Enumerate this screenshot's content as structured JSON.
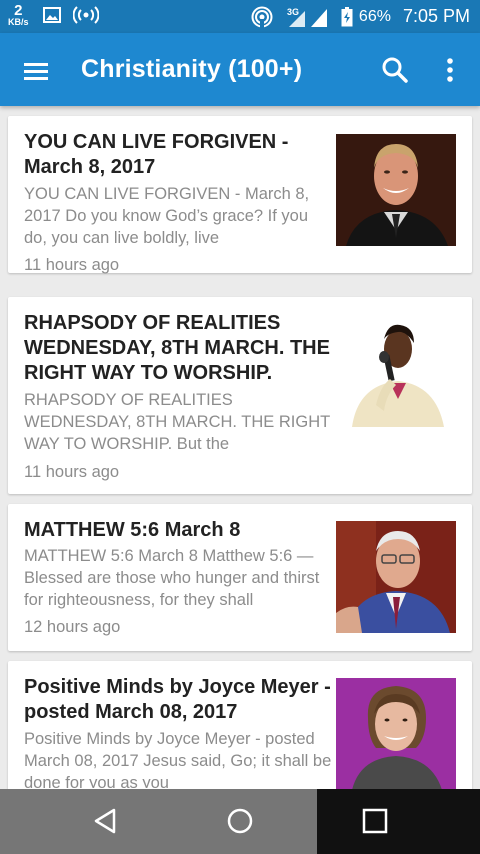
{
  "status_bar": {
    "net_speed_value": "2",
    "net_speed_unit": "KB/s",
    "battery": "66%",
    "time": "7:05 PM",
    "icons": [
      "image-icon",
      "broadcast-icon",
      "hotspot-icon",
      "3g-signal-icon",
      "battery-icon"
    ]
  },
  "app_bar": {
    "title": "Christianity (100+)",
    "icons": [
      "hamburger-menu-icon",
      "search-icon",
      "more-vert-icon"
    ]
  },
  "articles": [
    {
      "headline": "YOU CAN LIVE FORGIVEN - March 8, 2017",
      "summary": "YOU CAN LIVE FORGIVEN - March 8, 2017 Do you know God’s grace? If you do, you can live boldly, live",
      "time": "11 hours ago",
      "thumbnail": "preacher-portrait"
    },
    {
      "headline": "RHAPSODY OF REALITIES WEDNESDAY, 8TH MARCH. THE RIGHT WAY TO WORSHIP.",
      "summary": "RHAPSODY OF REALITIES WEDNESDAY, 8TH MARCH. THE RIGHT WAY TO WORSHIP. But the",
      "time": "11 hours ago",
      "thumbnail": "preacher-with-microphone"
    },
    {
      "headline": "MATTHEW 5:6  March 8",
      "summary": "MATTHEW 5:6  March 8 Matthew 5:6 —Blessed are those who hunger and thirst for righteousness, for they shall",
      "time": "12 hours ago",
      "thumbnail": "pastor-portrait"
    },
    {
      "headline": "Positive Minds  by Joyce Meyer - posted March 08, 2017",
      "summary": "Positive Minds by Joyce Meyer - posted March 08, 2017 Jesus said, Go; it shall be done for you as you",
      "time": "",
      "thumbnail": "joyce-meyer-portrait"
    }
  ],
  "nav_bar": {
    "icons": [
      "back-icon",
      "home-icon",
      "recents-icon"
    ]
  }
}
